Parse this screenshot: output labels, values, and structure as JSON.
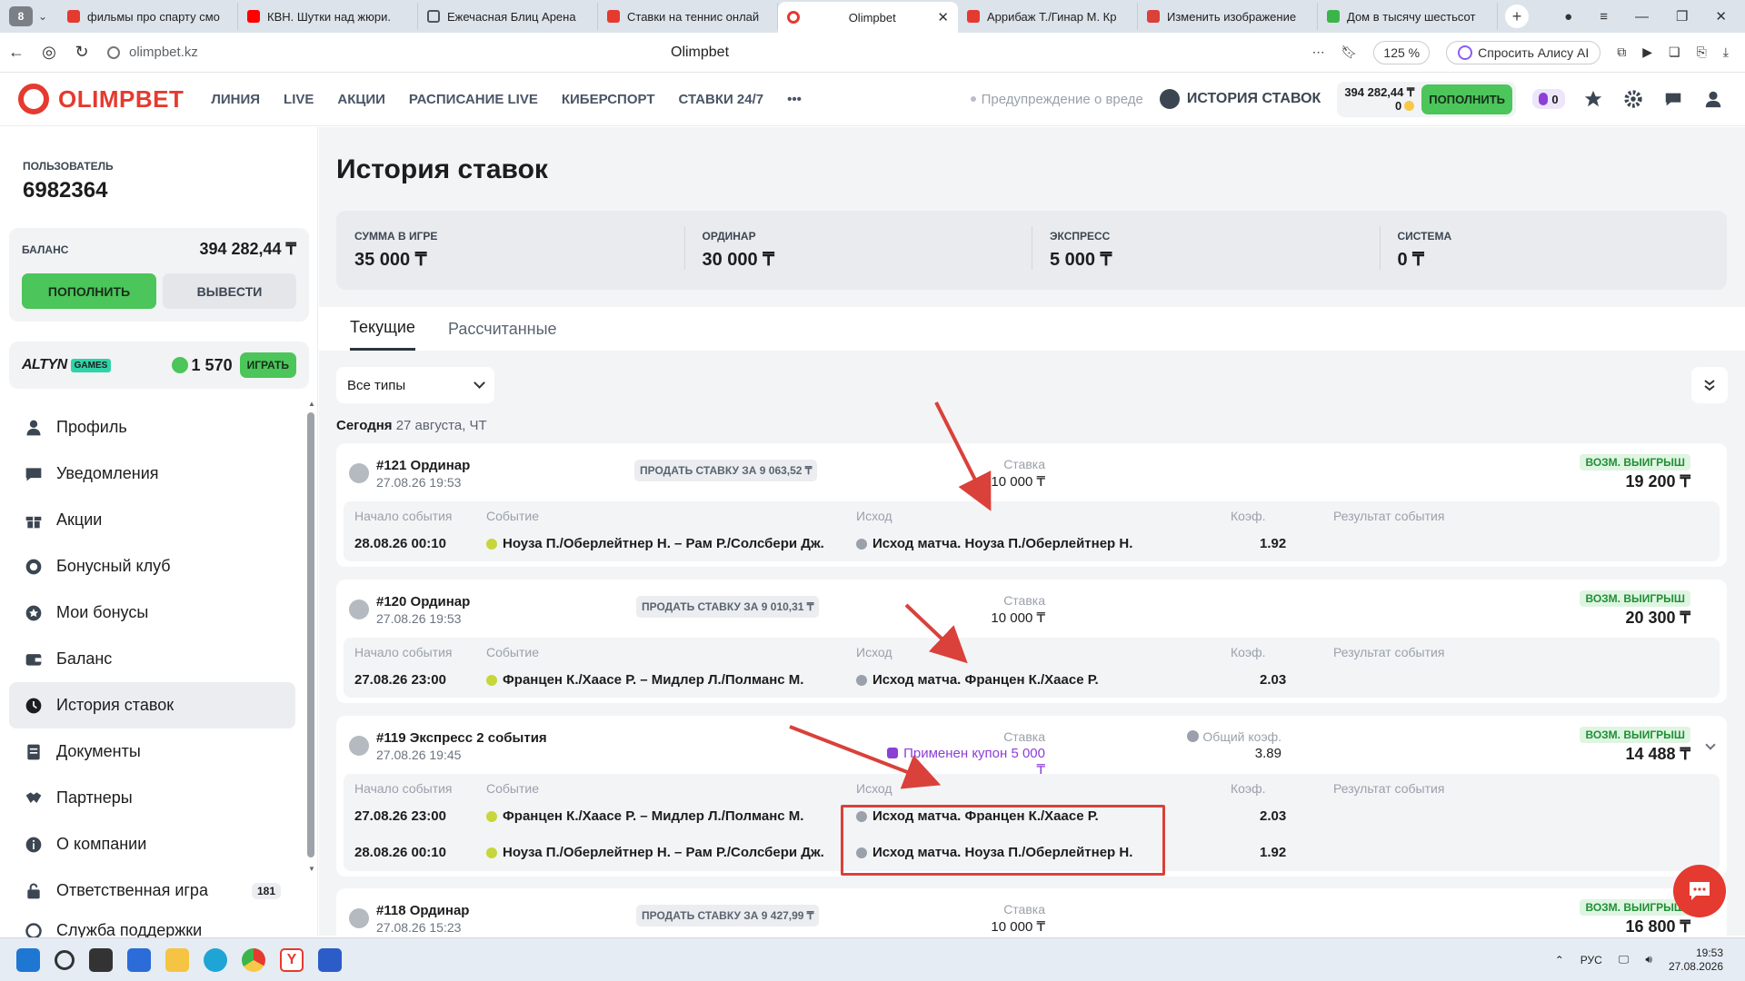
{
  "browser": {
    "tab_count": "8",
    "tabs": [
      {
        "label": "фильмы про спарту смо",
        "color": "#e53a2f"
      },
      {
        "label": "КВН. Шутки над жюри. ",
        "color": "#ff0000"
      },
      {
        "label": "Ежечасная Блиц Арена ",
        "color": "#555555"
      },
      {
        "label": "Ставки на теннис онлай",
        "color": "#e53a2f"
      },
      {
        "label": "Olimpbet",
        "color": "#e53a2f"
      },
      {
        "label": "Аррибаж Т./Гинар М. Кр",
        "color": "#e53a2f"
      },
      {
        "label": "Изменить изображение",
        "color": "#d9413a"
      },
      {
        "label": "Дом в тысячу шестьсот",
        "color": "#3bb54a"
      }
    ],
    "url": "olimpbet.kz",
    "page_title": "Olimpbet",
    "zoom": "125 %",
    "alice_label": "Спросить Алису AI"
  },
  "header": {
    "logo_text": "OLIMPBET",
    "nav": [
      "ЛИНИЯ",
      "LIVE",
      "АКЦИИ",
      "РАСПИСАНИЕ LIVE",
      "КИБЕРСПОРТ",
      "СТАВКИ 24/7"
    ],
    "more": "•••",
    "warning": "Предупреждение о вреде",
    "history": "ИСТОРИЯ СТАВОК",
    "balance": "394 282,44 ₸",
    "bonus": "0",
    "topup": "ПОПОЛНИТЬ",
    "promo_count": "0"
  },
  "sidebar": {
    "user_label": "ПОЛЬЗОВАТЕЛЬ",
    "user_id": "6982364",
    "balance_label": "БАЛАНС",
    "balance_value": "394 282,44 ₸",
    "topup": "ПОПОЛНИТЬ",
    "withdraw": "ВЫВЕСТИ",
    "games_brand": "ALTYN",
    "games_tag": "GAMES",
    "games_count": "1 570",
    "games_play": "ИГРАТЬ",
    "menu": [
      {
        "label": "Профиль",
        "icon": "person-icon"
      },
      {
        "label": "Уведомления",
        "icon": "chat-icon"
      },
      {
        "label": "Акции",
        "icon": "gift-icon"
      },
      {
        "label": "Бонусный клуб",
        "icon": "club-icon"
      },
      {
        "label": "Мои бонусы",
        "icon": "star-icon"
      },
      {
        "label": "Баланс",
        "icon": "wallet-icon"
      },
      {
        "label": "История ставок",
        "icon": "clock-icon",
        "active": true
      },
      {
        "label": "Документы",
        "icon": "document-icon"
      },
      {
        "label": "Партнеры",
        "icon": "handshake-icon"
      },
      {
        "label": "О компании",
        "icon": "info-icon"
      },
      {
        "label": "Ответственная игра",
        "icon": "lock-icon",
        "badge": "181"
      },
      {
        "label": "Служба поддержки",
        "icon": "support-icon"
      }
    ]
  },
  "main": {
    "title": "История ставок",
    "summary": [
      {
        "label": "СУММА В ИГРЕ",
        "value": "35 000 ₸"
      },
      {
        "label": "ОРДИНАР",
        "value": "30 000 ₸"
      },
      {
        "label": "ЭКСПРЕСС",
        "value": "5 000 ₸"
      },
      {
        "label": "СИСТЕМА",
        "value": "0 ₸"
      }
    ],
    "tabs": [
      "Текущие",
      "Рассчитанные"
    ],
    "filter": "Все типы",
    "day_label": "Сегодня",
    "day_date": "27 августа, ЧТ",
    "col_headers": {
      "start": "Начало события",
      "event": "Событие",
      "outcome": "Исход",
      "coef": "Коэф.",
      "result": "Результат события"
    },
    "stake_label": "Ставка",
    "win_label": "ВОЗМ. ВЫИГРЫШ",
    "total_coef_label": "Общий коэф.",
    "bets": [
      {
        "num": "#121 Ординар",
        "date": "27.08.26 19:53",
        "sell": "ПРОДАТЬ СТАВКУ ЗА 9 063,52 ₸",
        "stake": "10 000 ₸",
        "win": "19 200 ₸",
        "events": [
          {
            "start": "28.08.26 00:10",
            "event": "Ноуза П./Оберлейтнер Н. – Рам Р./Солсбери Дж.",
            "outcome": "Исход матча. Ноуза П./Оберлейтнер Н.",
            "coef": "1.92"
          }
        ]
      },
      {
        "num": "#120 Ординар",
        "date": "27.08.26 19:53",
        "sell": "ПРОДАТЬ СТАВКУ ЗА 9 010,31 ₸",
        "stake": "10 000 ₸",
        "win": "20 300 ₸",
        "events": [
          {
            "start": "27.08.26 23:00",
            "event": "Францен К./Хаасе Р. – Мидлер Л./Полманс М.",
            "outcome": "Исход матча. Францен К./Хаасе Р.",
            "coef": "2.03"
          }
        ]
      },
      {
        "num": "#119 Экспресс 2 события",
        "date": "27.08.26 19:45",
        "coupon": "Применен купон 5 000 ₸",
        "total_coef": "3.89",
        "win": "14 488 ₸",
        "events": [
          {
            "start": "27.08.26 23:00",
            "event": "Францен К./Хаасе Р. – Мидлер Л./Полманс М.",
            "outcome": "Исход матча. Францен К./Хаасе Р.",
            "coef": "2.03"
          },
          {
            "start": "28.08.26 00:10",
            "event": "Ноуза П./Оберлейтнер Н. – Рам Р./Солсбери Дж.",
            "outcome": "Исход матча. Ноуза П./Оберлейтнер Н.",
            "coef": "1.92"
          }
        ]
      },
      {
        "num": "#118 Ординар",
        "date": "27.08.26 15:23",
        "sell": "ПРОДАТЬ СТАВКУ ЗА 9 427,99 ₸",
        "stake": "10 000 ₸",
        "win": "16 800 ₸"
      }
    ]
  },
  "taskbar": {
    "lang": "РУС",
    "time": "19:53",
    "date": "27.08.2026"
  },
  "colors": {
    "brand": "#e53a2f",
    "accent_green": "#4cc55a",
    "annotation_red": "#d9413a"
  }
}
